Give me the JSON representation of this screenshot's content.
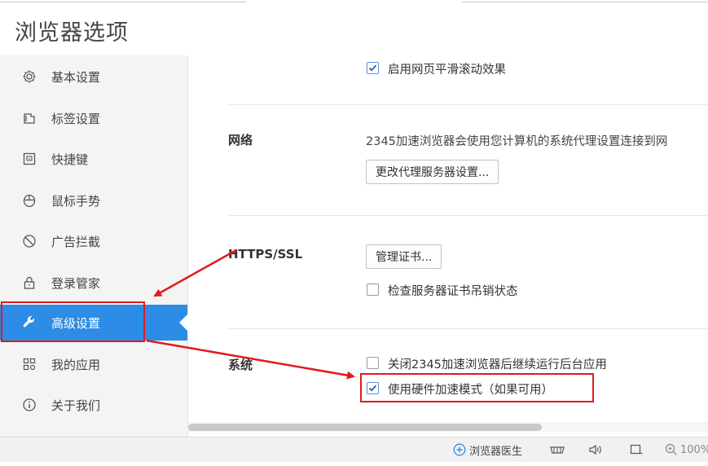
{
  "window": {
    "title": "浏览器选项"
  },
  "sidebar": {
    "items": [
      {
        "label": "基本设置",
        "icon": "gear-icon"
      },
      {
        "label": "标签设置",
        "icon": "tab-icon"
      },
      {
        "label": "快捷键",
        "icon": "keyboard-icon"
      },
      {
        "label": "鼠标手势",
        "icon": "mouse-icon"
      },
      {
        "label": "广告拦截",
        "icon": "block-icon"
      },
      {
        "label": "登录管家",
        "icon": "lock-icon"
      },
      {
        "label": "高级设置",
        "icon": "wrench-icon",
        "active": true
      },
      {
        "label": "我的应用",
        "icon": "apps-icon"
      },
      {
        "label": "关于我们",
        "icon": "info-icon"
      }
    ]
  },
  "main": {
    "smooth_scroll": {
      "label": "启用网页平滑滚动效果",
      "checked": true
    },
    "network": {
      "title": "网络",
      "description": "2345加速浏览器会使用您计算机的系统代理设置连接到网",
      "button": "更改代理服务器设置..."
    },
    "https": {
      "title": "HTTPS/SSL",
      "button": "管理证书...",
      "revocation": {
        "label": "检查服务器证书吊销状态",
        "checked": false
      }
    },
    "system": {
      "title": "系统",
      "background_apps": {
        "label": "关闭2345加速浏览器后继续运行后台应用",
        "checked": false
      },
      "hardware_accel": {
        "label": "使用硬件加速模式（如果可用）",
        "checked": true
      }
    }
  },
  "statusbar": {
    "doctor": "浏览器医生",
    "zoom": "100%"
  },
  "colors": {
    "accent": "#2d8ce5",
    "annotation": "#e01b1b"
  }
}
